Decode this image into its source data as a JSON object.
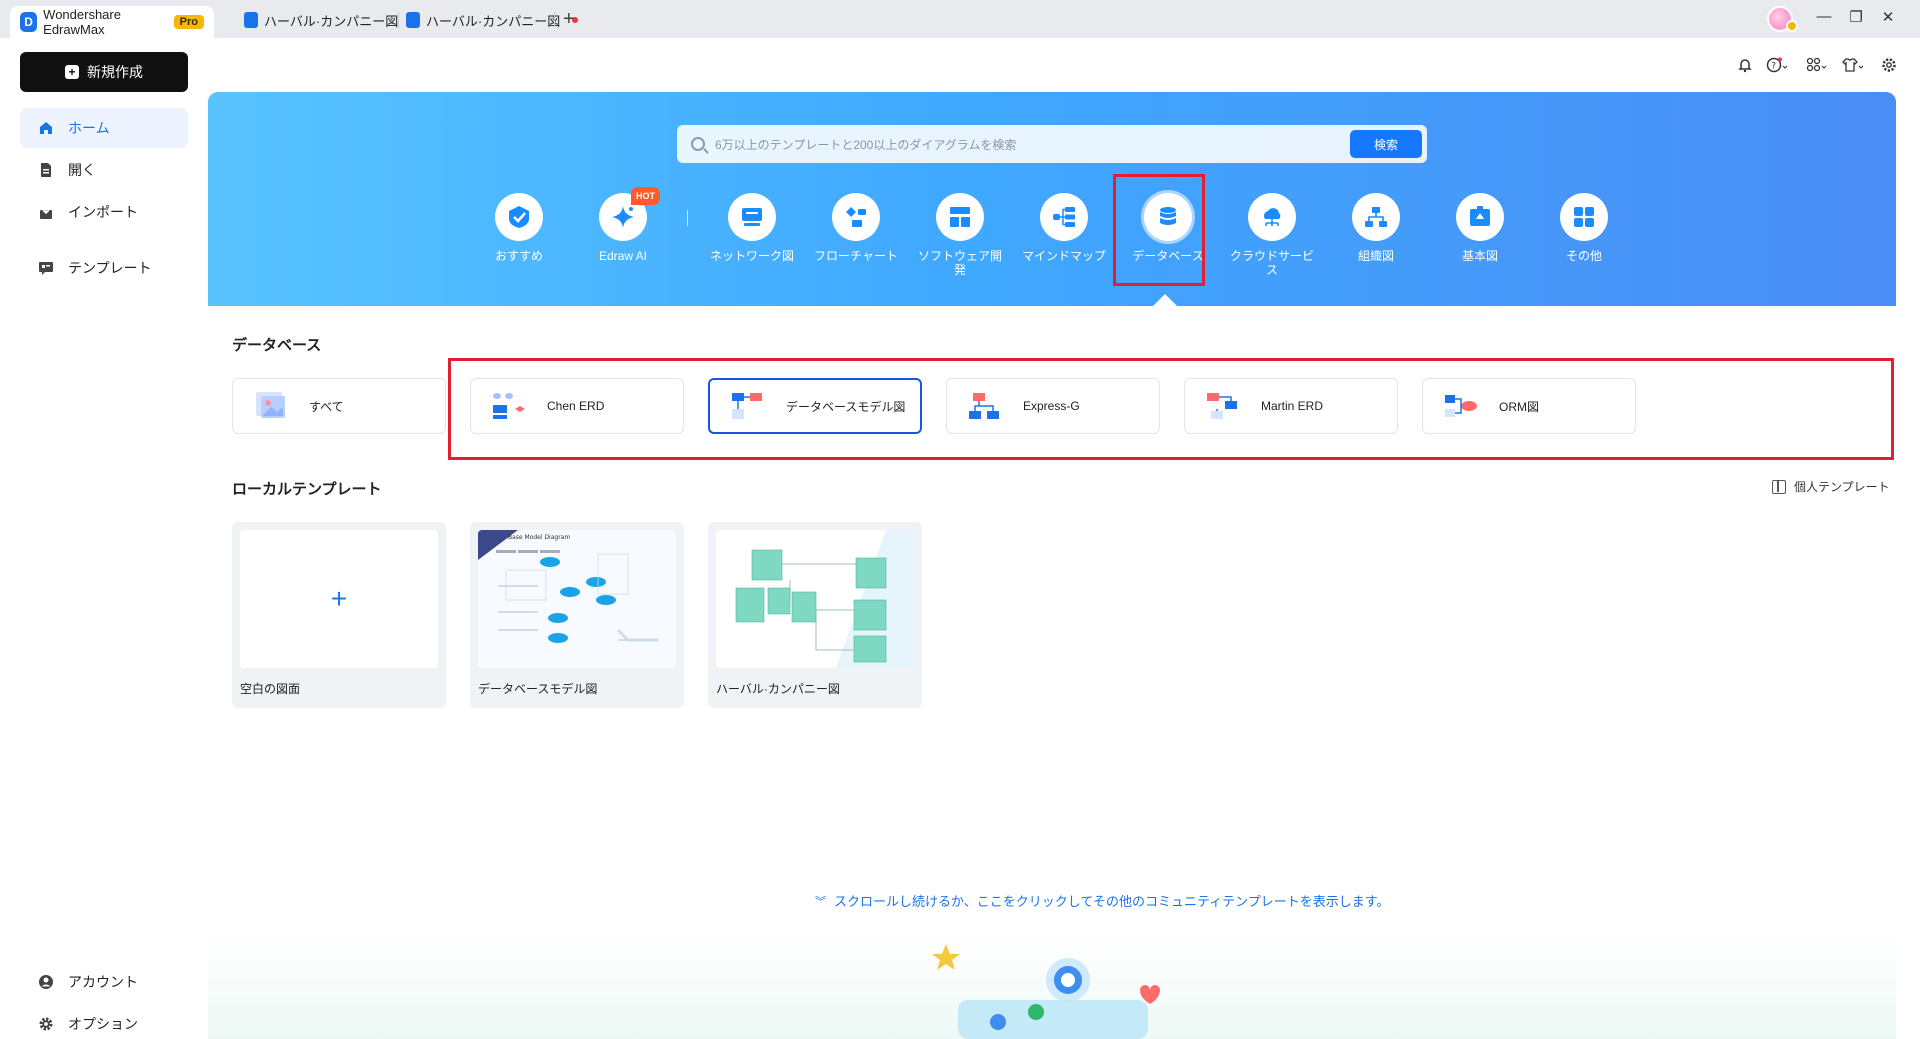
{
  "titlebar": {
    "app_name": "Wondershare EdrawMax",
    "pro_badge": "Pro",
    "tabs": [
      {
        "label": "ハーバル·カンパニー図"
      },
      {
        "label": "ハーバル·カンパニー図"
      }
    ],
    "new_tab": "+",
    "window_controls": {
      "minimize": "—",
      "restore": "❐",
      "close": "✕"
    }
  },
  "sidebar": {
    "new_button": "新規作成",
    "items": [
      {
        "label": "ホーム",
        "icon": "home-icon"
      },
      {
        "label": "開く",
        "icon": "open-icon"
      },
      {
        "label": "インポート",
        "icon": "import-icon"
      },
      {
        "label": "テンプレート",
        "icon": "template-icon"
      }
    ],
    "bottom_items": [
      {
        "label": "アカウント",
        "icon": "account-icon"
      },
      {
        "label": "オプション",
        "icon": "gear-icon"
      }
    ]
  },
  "hero": {
    "search_placeholder": "6万以上のテンプレートと200以上のダイアグラムを検索",
    "search_button": "検索",
    "categories": [
      {
        "label": "おすすめ",
        "icon": "recommend-icon"
      },
      {
        "label": "Edraw AI",
        "icon": "ai-sparkle-icon",
        "badge": "HOT"
      },
      {
        "label": "ネットワーク図",
        "icon": "network-icon"
      },
      {
        "label": "フローチャート",
        "icon": "flowchart-icon"
      },
      {
        "label": "ソフトウェア開\n発",
        "icon": "software-icon"
      },
      {
        "label": "マインドマップ",
        "icon": "mindmap-icon"
      },
      {
        "label": "データベース",
        "icon": "database-icon",
        "selected": true
      },
      {
        "label": "クラウドサービ\nス",
        "icon": "cloud-icon"
      },
      {
        "label": "組織図",
        "icon": "org-chart-icon"
      },
      {
        "label": "基本図",
        "icon": "basic-diagram-icon"
      },
      {
        "label": "その他",
        "icon": "more-icon"
      }
    ]
  },
  "database_section": {
    "title": "データベース",
    "templates": [
      {
        "label": "すべて"
      },
      {
        "label": "Chen ERD"
      },
      {
        "label": "データベースモデル図",
        "selected": true
      },
      {
        "label": "Express-G"
      },
      {
        "label": "Martin ERD"
      },
      {
        "label": "ORM図"
      }
    ]
  },
  "local_section": {
    "title": "ローカルテンプレート",
    "personal_templates": "個人テンプレート",
    "cards": [
      {
        "label": "空白の図面",
        "plus": "+"
      },
      {
        "label": "データベースモデル図",
        "preview_title": "Base Model Diagram"
      },
      {
        "label": "ハーバル·カンパニー図"
      }
    ]
  },
  "scroll_hint": "スクロールし続けるか、ここをクリックしてその他のコミュニティテンプレートを表示します。",
  "colors": {
    "accent": "#1a73e8",
    "hero_start": "#58c3ff",
    "hero_end": "#4a8df5",
    "highlight": "#e0202c",
    "hot": "#ff5a2c",
    "pro": "#f5b800"
  }
}
